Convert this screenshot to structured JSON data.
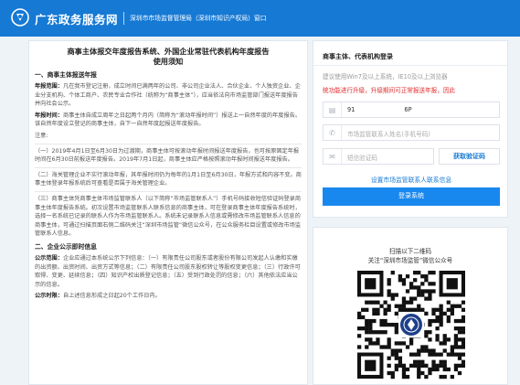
{
  "header": {
    "brand": "广东政务服务网",
    "subbrand": "深圳市市场监督管理局（深圳市知识产权局）窗口",
    "bg_color": "#1679d4"
  },
  "notice": {
    "title_line1": "商事主体报交年度报告系统、外国企业常驻代表机构年度报告",
    "title_line2": "使用须知",
    "sec1": "一、商事主体报送年报",
    "p1_label": "年报范围：",
    "p1_text": "凡在我市登记注册，成立时间已满两年的公司、非公司企业法人、合伙企业、个人独资企业、企业分支机构、个体工商户、农民专业合作社（统称为“商事主体”），应当依法向市场监管部门报送年度报告并向社会公示。",
    "p2_label": "年报时间：",
    "p2_text": "商事主体自成立周年之日起两个月内（简称为“滚动年报时间”）报送上一自然年度的年度报告。该自然年度设立登记的商事主体，自下一自然年度起报送年度报告。",
    "note_label": "注意:",
    "n1": "（一）2019年4月1日至6月30日为过渡期，商事主体可按滚动年报时间报送年度报告，也可按原固定年报时间在6月30日前报送年度报告。2019年7月1日起，商事主体应严格按照滚动年报时间报送年度报告。",
    "n2": "（二）海关管理企业不实行滚动年报，其年报时间仍为每年的1月1日至6月30日，年报方式和内容不变。商事主体登录年报系统后可查看是否属于海关管理企业。",
    "n3": "（三）商事主体凭商事主体市场监管联系人（以下简称“市场监管联系人”）手机号码接收短信验证码登录商事主体年度报告系统。初次设置市场监管联系人联系信息的商事主体，可在登录商事主体年度报告系统时，选择一名系统已记录的联系人作为市场监管联系人。系统未记录联系人信息或需修改市场监管联系人信息的商事主体，可通过扫描页面右侧二维码关注“深圳市场监管”微信公众号，在公众服务栏目设置或修改市场监管联系人信息。",
    "sec2": "二、企业公示即时信息",
    "p3_label": "公示范围：",
    "p3_text": "企业应通过本系统公示下列信息：（一）有限责任公司股东或者股份有限公司发起人认缴和实缴的出资额、出资时间、出资方式等信息；（二）有限责任公司股东股权转让等股权变更信息；（三）行政许可取得、变更、延续信息；（四）知识产权出质登记信息；（五）受到行政处罚的信息；（六）其他依法应当公示的信息。",
    "p4_label": "公示时限：",
    "p4_text": "自上述信息形成之日起20个工作日内。"
  },
  "login": {
    "title": "商事主体、代表机构登录",
    "tip1": "建议使用Win7及以上系统，IE10及以上浏览器",
    "tip2": "统功能进行升级，升级期间可正常报送年报，因此",
    "credit_value_a": "91",
    "credit_value_b": "6P",
    "name_placeholder": "市场监管联系人姓名(手机号码)",
    "code_placeholder": "短信验证码",
    "get_code": "获取验证码",
    "set_contact_link": "设置市场监管联系人联系信息",
    "login_button": "登录系统",
    "accent": "#1888ee",
    "warn_color": "#e02d2d"
  },
  "qr": {
    "line1": "扫描以下二维码",
    "line2": "关注“深圳市场监管”微信公众号"
  }
}
